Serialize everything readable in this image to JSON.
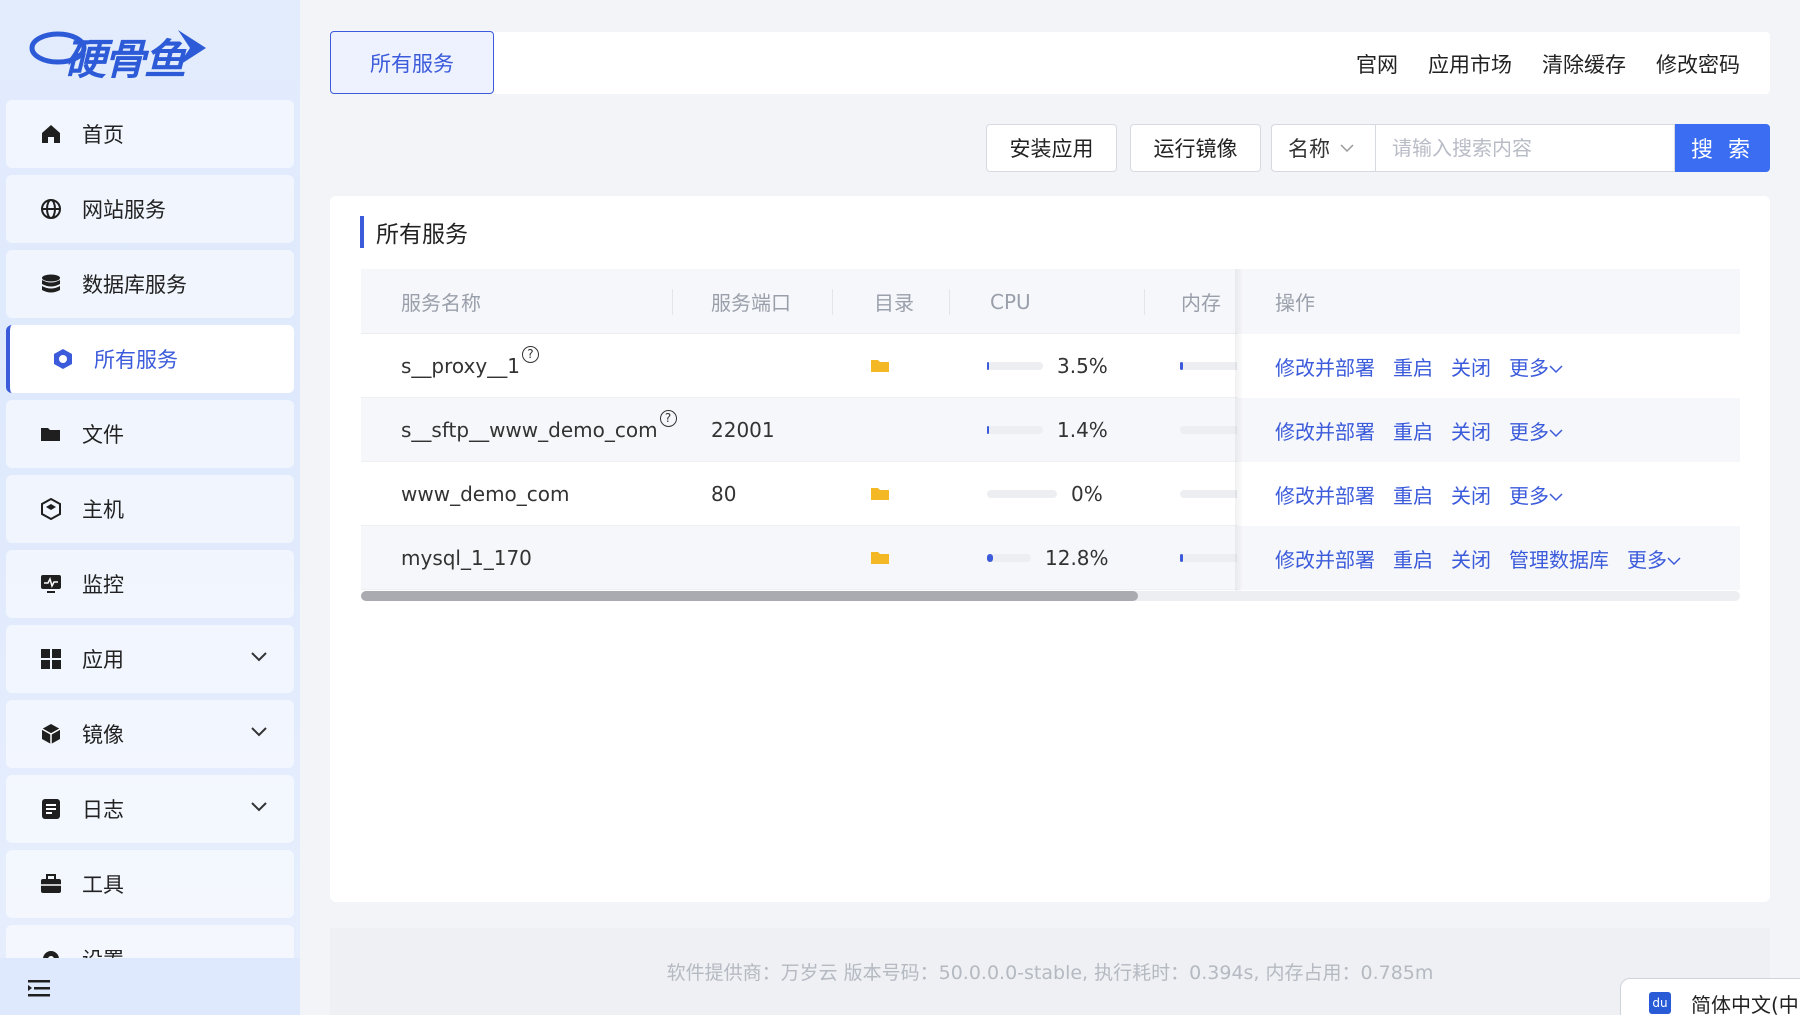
{
  "app": {
    "logo_text": "硬骨鱼"
  },
  "sidebar": {
    "items": [
      {
        "label": "首页",
        "icon": "home-icon"
      },
      {
        "label": "网站服务",
        "icon": "globe-icon"
      },
      {
        "label": "数据库服务",
        "icon": "database-icon"
      },
      {
        "label": "所有服务",
        "icon": "services-icon",
        "active": true
      },
      {
        "label": "文件",
        "icon": "folder-icon"
      },
      {
        "label": "主机",
        "icon": "host-icon"
      },
      {
        "label": "监控",
        "icon": "monitor-icon"
      },
      {
        "label": "应用",
        "icon": "apps-icon",
        "expandable": true
      },
      {
        "label": "镜像",
        "icon": "cube-icon",
        "expandable": true
      },
      {
        "label": "日志",
        "icon": "log-icon",
        "expandable": true
      },
      {
        "label": "工具",
        "icon": "toolbox-icon"
      },
      {
        "label": "设置",
        "icon": "settings-icon"
      }
    ]
  },
  "header": {
    "active_tab": "所有服务",
    "links": [
      "官网",
      "应用市场",
      "清除缓存",
      "修改密码"
    ]
  },
  "toolbar": {
    "install_label": "安装应用",
    "run_image_label": "运行镜像",
    "search_field_select": "名称",
    "search_placeholder": "请输入搜索内容",
    "search_button": "搜 索"
  },
  "card": {
    "title": "所有服务"
  },
  "table": {
    "columns": [
      "服务名称",
      "服务端口",
      "目录",
      "CPU",
      "内存",
      "操作"
    ],
    "rows": [
      {
        "name": "s__proxy__1",
        "help": "?",
        "port": "",
        "has_dir": true,
        "cpu": "3.5%",
        "cpu_fraction": 0.035,
        "mem_fraction": 0.03,
        "ops": [
          "修改并部署",
          "重启",
          "关闭",
          "更多"
        ]
      },
      {
        "name": "s__sftp__www_demo_com",
        "help": "?",
        "port": "22001",
        "has_dir": false,
        "cpu": "1.4%",
        "cpu_fraction": 0.014,
        "mem_fraction": 0.0,
        "ops": [
          "修改并部署",
          "重启",
          "关闭",
          "更多"
        ]
      },
      {
        "name": "www_demo_com",
        "help": "",
        "port": "80",
        "has_dir": true,
        "cpu": "0%",
        "cpu_fraction": 0.0,
        "mem_fraction": 0.0,
        "ops": [
          "修改并部署",
          "重启",
          "关闭",
          "更多"
        ]
      },
      {
        "name": "mysql_1_170",
        "help": "",
        "port": "",
        "has_dir": true,
        "cpu": "12.8%",
        "cpu_fraction": 0.128,
        "mem_fraction": 0.03,
        "ops": [
          "修改并部署",
          "重启",
          "关闭",
          "管理数据库",
          "更多"
        ]
      }
    ]
  },
  "footer": {
    "text": "软件提供商：万岁云    版本号码：50.0.0.0-stable, 执行耗时：0.394s, 内存占用：0.785m"
  },
  "language": {
    "badge": "du",
    "label": "简体中文(中"
  },
  "colors": {
    "accent": "#3b5bdb",
    "search_button": "#3b6df2",
    "folder": "#f5b825"
  }
}
